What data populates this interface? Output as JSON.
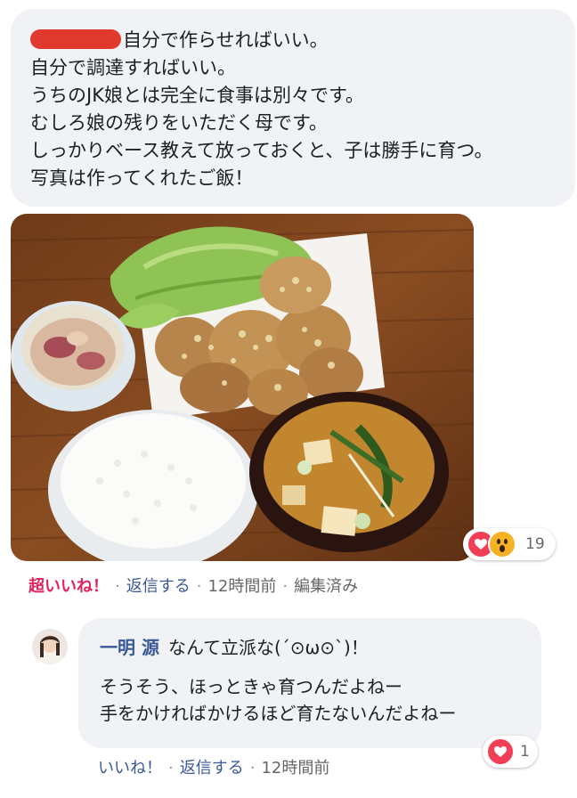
{
  "post": {
    "lines": [
      "自分で作らせればいい。",
      "自分で調達すればいい。",
      "うちのJK娘とは完全に食事は別々です。",
      "むしろ娘の残りをいただく母です。",
      "しっかりベース教えて放っておくと、子は勝手に育つ。",
      "写真は作ってくれたご飯！"
    ],
    "reactions": {
      "icons": [
        "love-reaction",
        "wow-reaction"
      ],
      "count": "19"
    },
    "meta": {
      "reaction": "超いいね！",
      "reply": "返信する",
      "time": "12時間前",
      "edited": "編集済み",
      "separator": "·"
    }
  },
  "reply": {
    "author": "一明 源",
    "lines": [
      "なんて立派な(´⊙ω⊙`)！",
      "そうそう、ほっときゃ育つんだよねー",
      "手をかければかけるほど育たないんだよねー"
    ],
    "reactions": {
      "icons": [
        "love-reaction"
      ],
      "count": "1"
    },
    "meta": {
      "like": "いいね！",
      "reply": "返信する",
      "time": "12時間前",
      "separator": "·"
    }
  },
  "colors": {
    "bubble": "#f0f2f5",
    "link": "#3b5998",
    "love": "#f33e58",
    "wow": "#f7b125",
    "super_like": "#e0245e"
  }
}
